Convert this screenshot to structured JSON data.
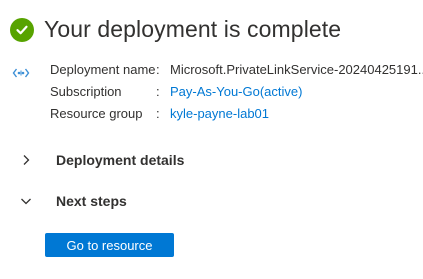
{
  "header": {
    "title": "Your deployment is complete",
    "status_icon": "success-check-icon",
    "status_color": "#57a300"
  },
  "deployment": {
    "icon": "deployment-icon",
    "rows": [
      {
        "label": "Deployment name",
        "value": "Microsoft.PrivateLinkService-20240425191...",
        "is_link": false
      },
      {
        "label": "Subscription",
        "value": "Pay-As-You-Go(active)",
        "is_link": true
      },
      {
        "label": "Resource group",
        "value": "kyle-payne-lab01",
        "is_link": true
      }
    ],
    "separator": ":"
  },
  "sections": {
    "details": {
      "label": "Deployment details",
      "expanded": false
    },
    "next_steps": {
      "label": "Next steps",
      "expanded": true
    }
  },
  "actions": {
    "go_to_resource": "Go to resource"
  },
  "colors": {
    "link": "#0078d4",
    "primary_button": "#0078d4",
    "text": "#323130"
  }
}
